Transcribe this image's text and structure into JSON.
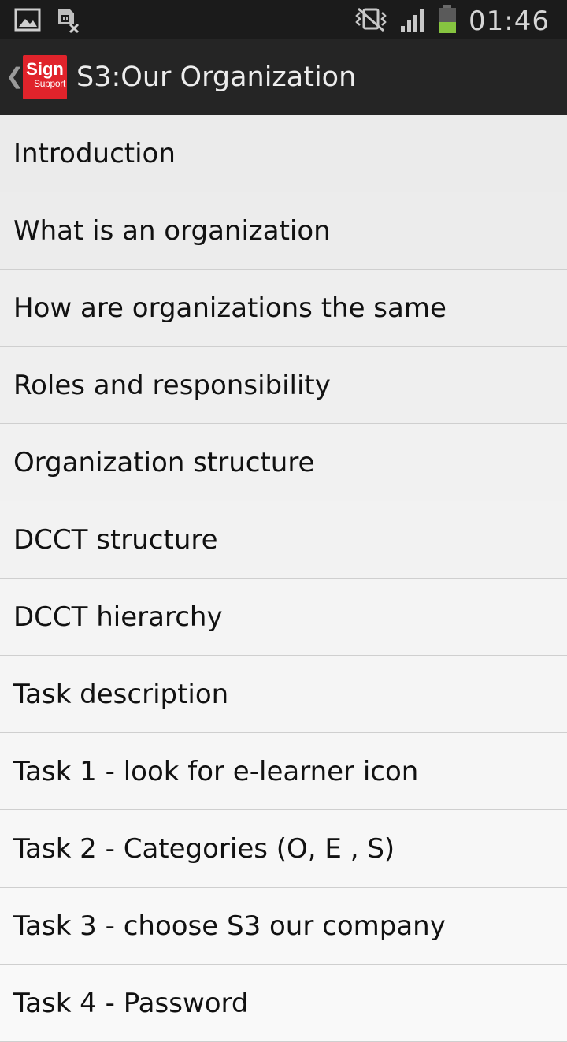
{
  "status_bar": {
    "time": "01:46",
    "left_icons": [
      "gallery-icon",
      "sim-off-icon"
    ],
    "right_icons": [
      "vibrate-icon",
      "signal-icon",
      "battery-icon"
    ]
  },
  "action_bar": {
    "up_glyph": "❮",
    "logo_line1": "Sign",
    "logo_line2": "Support",
    "title": "S3:Our Organization"
  },
  "list": {
    "items": [
      {
        "label": "Introduction",
        "bg": "#ebebeb"
      },
      {
        "label": "What is an organization",
        "bg": "#ececec"
      },
      {
        "label": "How are organizations the same",
        "bg": "#eeeeee"
      },
      {
        "label": "Roles and responsibility",
        "bg": "#efefef"
      },
      {
        "label": "Organization structure",
        "bg": "#f1f1f1"
      },
      {
        "label": "DCCT structure",
        "bg": "#f2f2f2"
      },
      {
        "label": "DCCT hierarchy",
        "bg": "#f4f4f4"
      },
      {
        "label": "Task description",
        "bg": "#f5f5f5"
      },
      {
        "label": "Task 1 - look for e-learner icon",
        "bg": "#f6f6f6"
      },
      {
        "label": "Task 2 - Categories (O, E , S)",
        "bg": "#f7f7f7"
      },
      {
        "label": "Task 3 - choose S3 our company",
        "bg": "#f8f8f8"
      },
      {
        "label": "Task 4 - Password",
        "bg": "#f9f9f9"
      }
    ]
  },
  "colors": {
    "status_bar": "#1b1b1b",
    "action_bar": "#252525",
    "logo_red": "#e0232b",
    "battery_green": "#86c440"
  }
}
